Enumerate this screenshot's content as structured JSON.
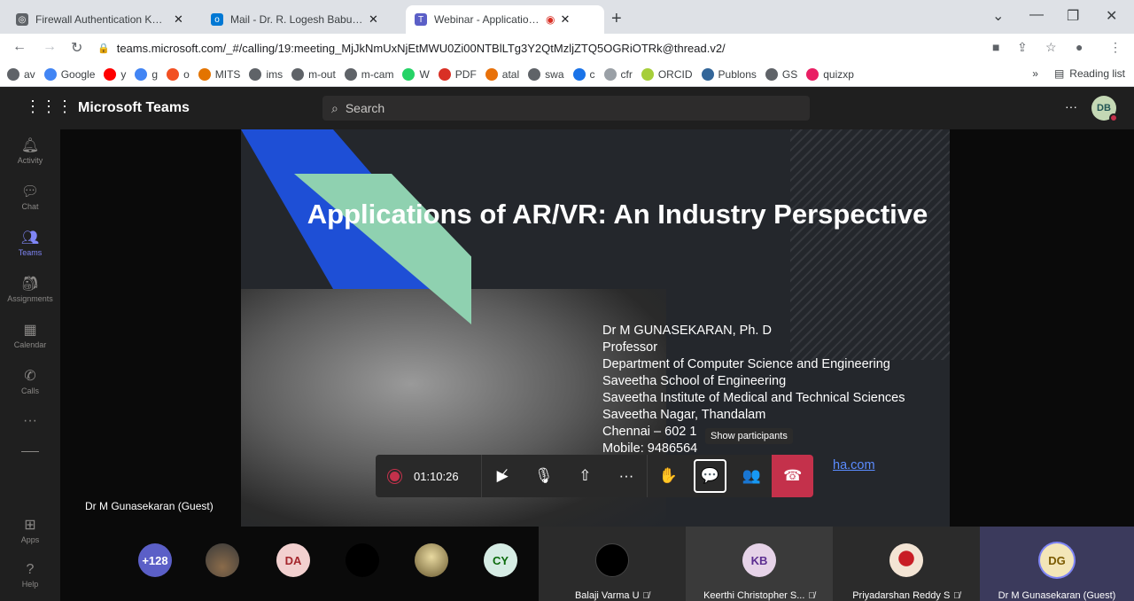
{
  "browser": {
    "tabs": [
      {
        "title": "Firewall Authentication Keepalive",
        "icon": "globe-icon"
      },
      {
        "title": "Mail - Dr. R. Logesh Babu - Outlook",
        "icon": "outlook-icon"
      },
      {
        "title": "Webinar - Applications of AR/VR",
        "icon": "teams-icon",
        "recording": true
      }
    ],
    "url": "teams.microsoft.com/_#/calling/19:meeting_MjJkNmUxNjEtMWU0Zi00NTBlLTg3Y2QtMzljZTQ5OGRiOTRk@thread.v2/",
    "bookmarks": [
      {
        "label": "av",
        "color": "#5f6368"
      },
      {
        "label": "Google",
        "color": "#4285f4"
      },
      {
        "label": "y",
        "color": "#ff0000"
      },
      {
        "label": "g",
        "color": "#4285f4"
      },
      {
        "label": "o",
        "color": "#f25022"
      },
      {
        "label": "MITS",
        "color": "#e37400"
      },
      {
        "label": "ims",
        "color": "#5f6368"
      },
      {
        "label": "m-out",
        "color": "#5f6368"
      },
      {
        "label": "m-cam",
        "color": "#5f6368"
      },
      {
        "label": "W",
        "color": "#25d366"
      },
      {
        "label": "PDF",
        "color": "#d93025"
      },
      {
        "label": "atal",
        "color": "#e8710a"
      },
      {
        "label": "swa",
        "color": "#5f6368"
      },
      {
        "label": "c",
        "color": "#1a73e8"
      },
      {
        "label": "cfr",
        "color": "#9aa0a6"
      },
      {
        "label": "ORCID",
        "color": "#a6ce39"
      },
      {
        "label": "Publons",
        "color": "#336699"
      },
      {
        "label": "GS",
        "color": "#5f6368"
      },
      {
        "label": "quizxp",
        "color": "#e91e63"
      }
    ],
    "bookmarks_overflow": "»",
    "reading_list": "Reading list"
  },
  "teams": {
    "app_title": "Microsoft Teams",
    "search_placeholder": "Search",
    "user_initials": "DB",
    "rail": [
      {
        "label": "Activity",
        "icon": "bell-icon"
      },
      {
        "label": "Chat",
        "icon": "chat-icon"
      },
      {
        "label": "Teams",
        "icon": "teams-icon",
        "active": true
      },
      {
        "label": "Assignments",
        "icon": "backpack-icon"
      },
      {
        "label": "Calendar",
        "icon": "calendar-icon"
      },
      {
        "label": "Calls",
        "icon": "phone-icon"
      },
      {
        "label": "...",
        "icon": "more-icon"
      },
      {
        "label": "Apps",
        "icon": "apps-icon"
      },
      {
        "label": "Help",
        "icon": "help-icon"
      }
    ]
  },
  "slide": {
    "title": "Applications of AR/VR: An Industry Perspective",
    "lines": [
      "Dr M GUNASEKARAN, Ph. D",
      "Professor",
      "Department of Computer Science and Engineering",
      "Saveetha School of Engineering",
      "Saveetha Institute of Medical and Technical Sciences",
      "Saveetha Nagar, Thandalam",
      "Chennai – 602 1",
      "Mobile: 9486564",
      "ha.com"
    ],
    "presenter": "Dr M Gunasekaran (Guest)"
  },
  "call": {
    "timer": "01:10:26",
    "tooltip": "Show participants"
  },
  "gallery": {
    "overflow": "+128",
    "avatars": [
      {
        "initials": "DA",
        "bg": "#f2d0cf",
        "fg": "#a4262c"
      },
      {
        "initials": "CY",
        "bg": "#d6ece4",
        "fg": "#0b6a0b"
      }
    ],
    "tiles": [
      {
        "name": "Balaji Varma U"
      },
      {
        "name": "Keerthi Christopher S...",
        "initials": "KB"
      },
      {
        "name": "Priyadarshan Reddy S"
      },
      {
        "name": "Dr M Gunasekaran (Guest)",
        "initials": "DG"
      }
    ]
  }
}
